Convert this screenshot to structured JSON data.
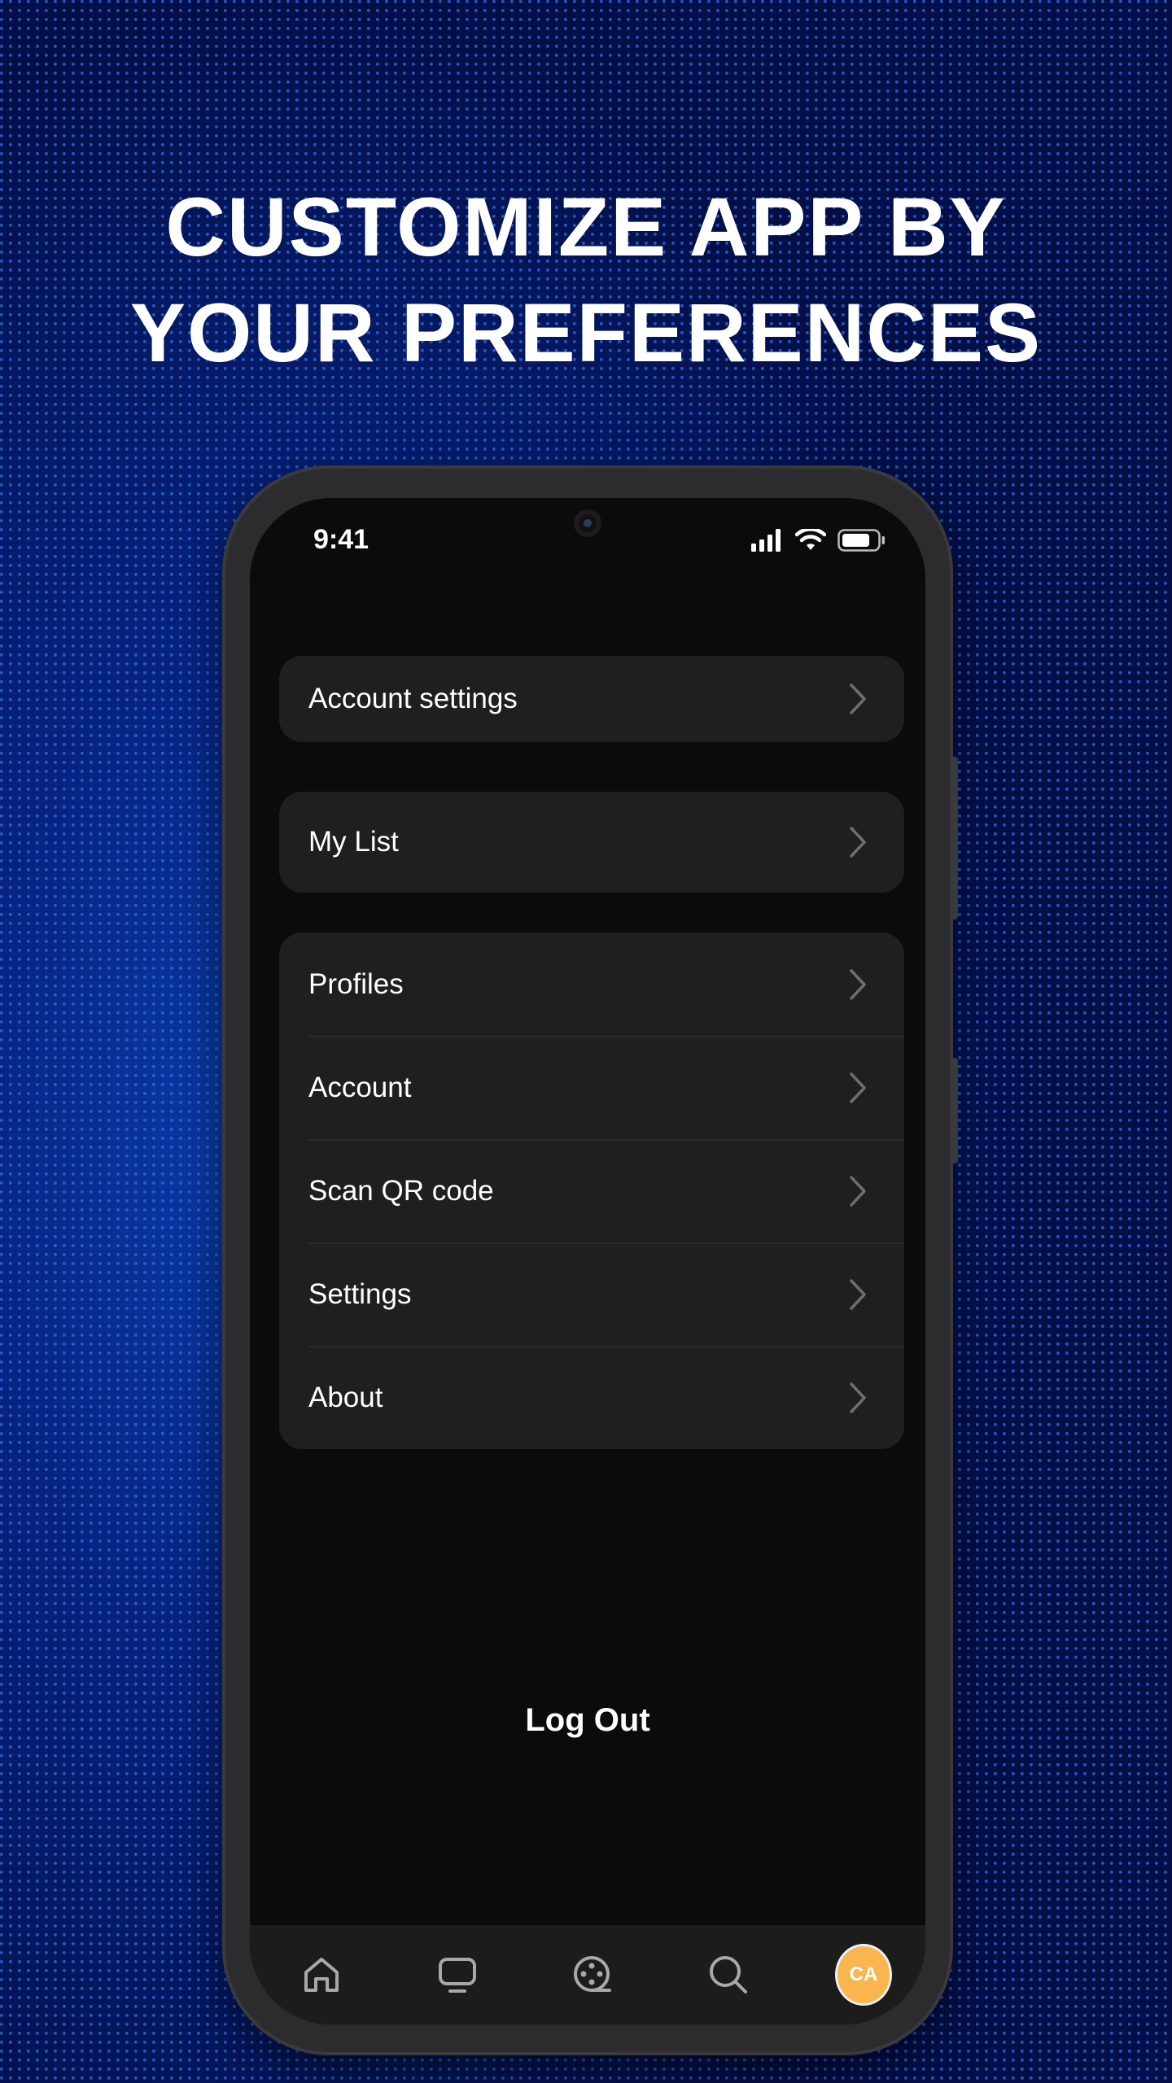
{
  "headline": {
    "line1": "CUSTOMIZE APP BY",
    "line2": "YOUR PREFERENCES"
  },
  "status_bar": {
    "time": "9:41",
    "icons": [
      "signal-icon",
      "wifi-icon",
      "battery-icon"
    ]
  },
  "menu_groups": [
    {
      "items": [
        {
          "label": "Account settings",
          "icon": "chevron-right-icon"
        }
      ]
    },
    {
      "items": [
        {
          "label": "My List",
          "icon": "chevron-right-icon"
        }
      ]
    },
    {
      "items": [
        {
          "label": "Profiles",
          "icon": "chevron-right-icon"
        },
        {
          "label": "Account",
          "icon": "chevron-right-icon"
        },
        {
          "label": "Scan QR code",
          "icon": "chevron-right-icon"
        },
        {
          "label": "Settings",
          "icon": "chevron-right-icon"
        },
        {
          "label": "About",
          "icon": "chevron-right-icon"
        }
      ]
    }
  ],
  "logout_label": "Log Out",
  "tab_bar": {
    "tabs": [
      {
        "icon": "home-icon"
      },
      {
        "icon": "tv-icon"
      },
      {
        "icon": "film-reel-icon"
      },
      {
        "icon": "search-icon"
      }
    ],
    "avatar_initials": "CA",
    "avatar_color": "#f9b54e"
  },
  "colors": {
    "background": "#061a63",
    "screen": "#0b0b0b",
    "card": "#1f1f1f",
    "text": "#ffffff",
    "chevron": "#6e6e6e"
  }
}
